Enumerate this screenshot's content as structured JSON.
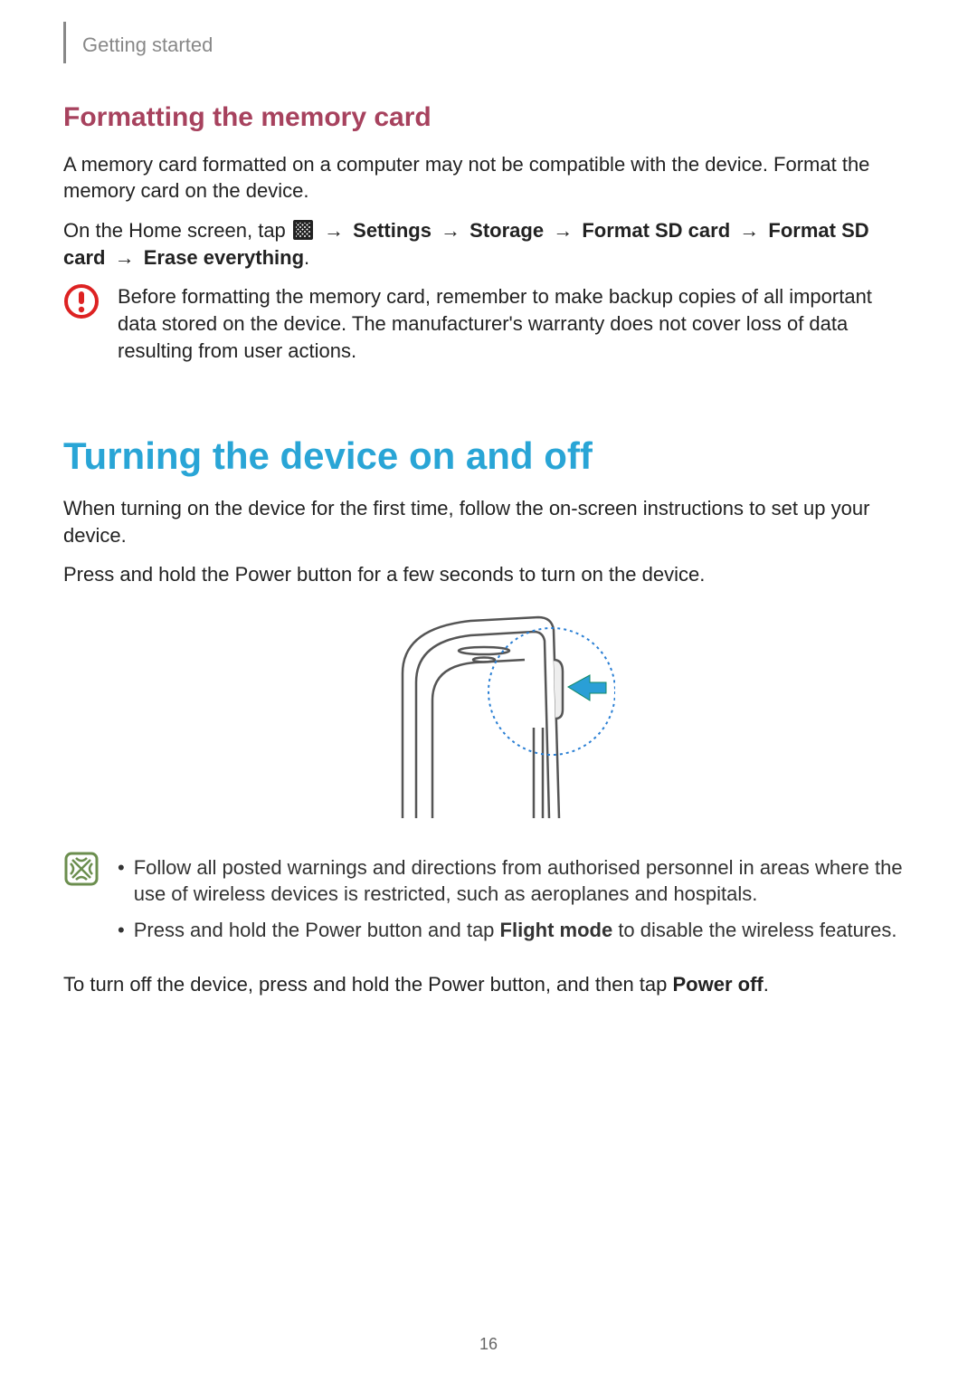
{
  "chapter": "Getting started",
  "section1": {
    "heading": "Formatting the memory card",
    "p1": "A memory card formatted on a computer may not be compatible with the device. Format the memory card on the device.",
    "nav_prefix": "On the Home screen, tap ",
    "arrow": " → ",
    "nav_steps": [
      "Settings",
      "Storage",
      "Format SD card",
      "Format SD card",
      "Erase everything"
    ],
    "warning": "Before formatting the memory card, remember to make backup copies of all important data stored on the device. The manufacturer's warranty does not cover loss of data resulting from user actions."
  },
  "section2": {
    "heading": "Turning the device on and off",
    "p1": "When turning on the device for the first time, follow the on-screen instructions to set up your device.",
    "p2": "Press and hold the Power button for a few seconds to turn on the device.",
    "tip1": "Follow all posted warnings and directions from authorised personnel in areas where the use of wireless devices is restricted, such as aeroplanes and hospitals.",
    "tip2_a": "Press and hold the Power button and tap ",
    "tip2_bold": "Flight mode",
    "tip2_b": " to disable the wireless features.",
    "p3_a": "To turn off the device, press and hold the Power button, and then tap ",
    "p3_bold": "Power off",
    "p3_b": "."
  },
  "page_number": "16",
  "icons": {
    "caution_color": "#d22",
    "tip_color": "#6b8e4e"
  }
}
